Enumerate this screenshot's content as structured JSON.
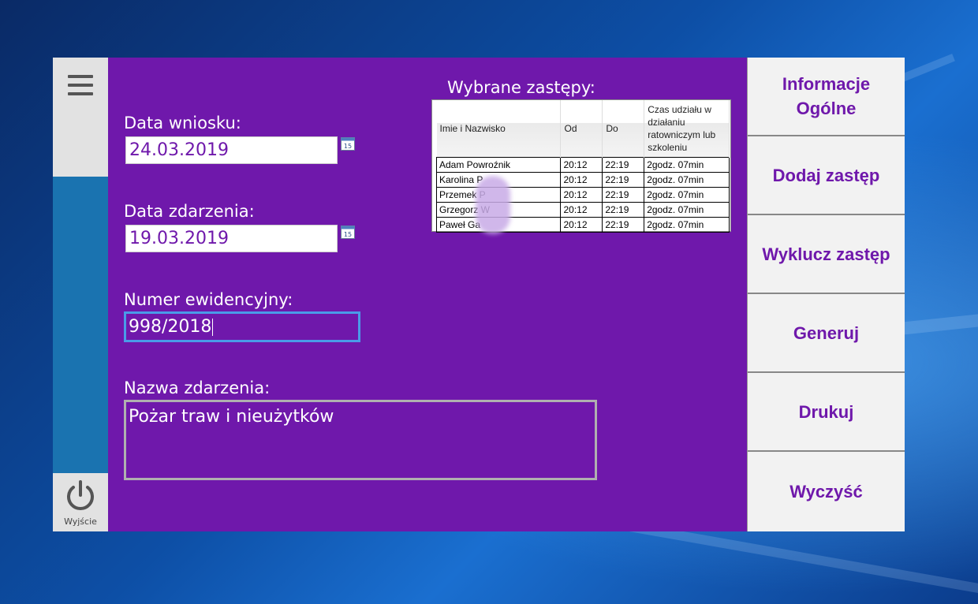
{
  "app": {
    "exit_label": "Wyjście"
  },
  "form": {
    "request_date_label": "Data wniosku:",
    "request_date_value": "24.03.2019",
    "event_date_label": "Data zdarzenia:",
    "event_date_value": "19.03.2019",
    "record_number_label": "Numer ewidencyjny:",
    "record_number_value": "998/2018",
    "event_name_label": "Nazwa zdarzenia:",
    "event_name_value": "Pożar traw i nieużytków",
    "calendar_icon_day": "15"
  },
  "selected": {
    "title": "Wybrane zastępy:",
    "columns": [
      "Imie i Nazwisko",
      "Od",
      "Do",
      "Czas udziału w działaniu ratowniczym lub szkoleniu"
    ],
    "rows": [
      {
        "name": "Adam Powroźnik",
        "from": "20:12",
        "to": "22:19",
        "time": "2godz. 07min"
      },
      {
        "name": "Karolina P",
        "from": "20:12",
        "to": "22:19",
        "time": "2godz. 07min"
      },
      {
        "name": "Przemek P",
        "from": "20:12",
        "to": "22:19",
        "time": "2godz. 07min"
      },
      {
        "name": "Grzegorz W",
        "from": "20:12",
        "to": "22:19",
        "time": "2godz. 07min"
      },
      {
        "name": "Paweł Ga",
        "from": "20:12",
        "to": "22:19",
        "time": "2godz. 07min"
      }
    ]
  },
  "side_buttons": [
    "Informacje Ogólne",
    "Dodaj zastęp",
    "Wyklucz zastęp",
    "Generuj",
    "Drukuj",
    "Wyczyść"
  ],
  "colors": {
    "panel": "#6f18ab",
    "rail": "#1a73b0",
    "accent_text": "#6f18ab",
    "focus_border": "#4a9be8"
  },
  "icons": [
    "menu-icon",
    "calendar-icon",
    "power-icon"
  ]
}
